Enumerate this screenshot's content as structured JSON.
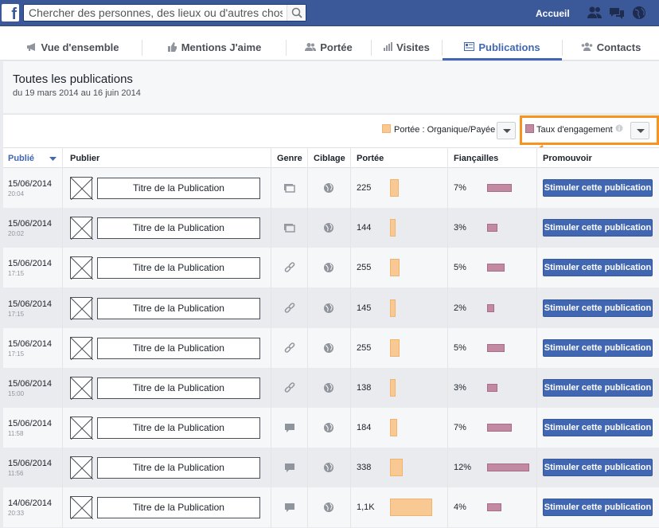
{
  "topbar": {
    "search_placeholder": "Chercher des personnes, des lieux ou d'autres choses",
    "home_label": "Accueil",
    "icons": [
      "facebook-logo",
      "search-icon",
      "friends-icon",
      "messages-icon",
      "globe-icon"
    ]
  },
  "tabs": [
    {
      "label": "Vue d'ensemble",
      "icon": "megaphone-icon"
    },
    {
      "label": "Mentions J'aime",
      "icon": "thumbs-up-icon"
    },
    {
      "label": "Portée",
      "icon": "people-icon"
    },
    {
      "label": "Visites",
      "icon": "bars-icon"
    },
    {
      "label": "Publications",
      "icon": "list-icon",
      "active": true
    },
    {
      "label": "Contacts",
      "icon": "contacts-icon"
    }
  ],
  "header": {
    "title": "Toutes les publications",
    "date_range": "du 19 mars 2014 au 16 juin 2014"
  },
  "legend": {
    "reach_label": "Portée : Organique/Payée",
    "engagement_label": "Taux d'engagement",
    "reach_color": "#f9c993",
    "engagement_color": "#c28aa2"
  },
  "columns": {
    "published": "Publié",
    "post": "Publier",
    "type": "Genre",
    "targeting": "Ciblage",
    "reach": "Portée",
    "engagement": "Fiançailles",
    "promote": "Promouvoir"
  },
  "rows": [
    {
      "date": "15/06/2014",
      "time": "20:04",
      "title": "Titre de la Publication",
      "type": "photo-icon",
      "reach": "225",
      "reach_value": 225,
      "engagement": "7%",
      "engagement_value": 7,
      "boost": "Stimuler cette publication"
    },
    {
      "date": "15/06/2014",
      "time": "20:02",
      "title": "Titre de la Publication",
      "type": "photo-icon",
      "reach": "144",
      "reach_value": 144,
      "engagement": "3%",
      "engagement_value": 3,
      "boost": "Stimuler cette publication"
    },
    {
      "date": "15/06/2014",
      "time": "17:15",
      "title": "Titre de la Publication",
      "type": "link-icon",
      "reach": "255",
      "reach_value": 255,
      "engagement": "5%",
      "engagement_value": 5,
      "boost": "Stimuler cette publication"
    },
    {
      "date": "15/06/2014",
      "time": "17:15",
      "title": "Titre de la Publication",
      "type": "link-icon",
      "reach": "145",
      "reach_value": 145,
      "engagement": "2%",
      "engagement_value": 2,
      "boost": "Stimuler cette publication"
    },
    {
      "date": "15/06/2014",
      "time": "17:15",
      "title": "Titre de la Publication",
      "type": "link-icon",
      "reach": "255",
      "reach_value": 255,
      "engagement": "5%",
      "engagement_value": 5,
      "boost": "Stimuler cette publication"
    },
    {
      "date": "15/06/2014",
      "time": "15:00",
      "title": "Titre de la Publication",
      "type": "link-icon",
      "reach": "138",
      "reach_value": 138,
      "engagement": "3%",
      "engagement_value": 3,
      "boost": "Stimuler cette publication"
    },
    {
      "date": "15/06/2014",
      "time": "11:58",
      "title": "Titre de la Publication",
      "type": "status-icon",
      "reach": "184",
      "reach_value": 184,
      "engagement": "7%",
      "engagement_value": 7,
      "boost": "Stimuler cette publication"
    },
    {
      "date": "15/06/2014",
      "time": "11:56",
      "title": "Titre de la Publication",
      "type": "status-icon",
      "reach": "338",
      "reach_value": 338,
      "engagement": "12%",
      "engagement_value": 12,
      "boost": "Stimuler cette publication"
    },
    {
      "date": "14/06/2014",
      "time": "20:33",
      "title": "Titre de la Publication",
      "type": "status-icon",
      "reach": "1,1K",
      "reach_value": 1100,
      "engagement": "4%",
      "engagement_value": 4,
      "boost": "Stimuler cette publication"
    }
  ]
}
